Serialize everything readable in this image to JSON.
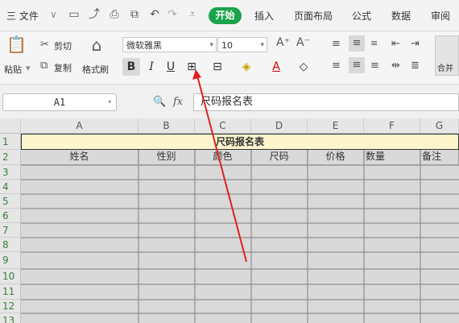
{
  "menubar": {
    "file_label": "三 文件",
    "tabs": [
      "开始",
      "插入",
      "页面布局",
      "公式",
      "数据",
      "审阅"
    ],
    "quick_icons": [
      "save-icon",
      "export-icon",
      "print-icon",
      "preview-icon",
      "undo-icon",
      "redo-icon",
      "more-icon"
    ]
  },
  "ribbon": {
    "paste": "粘贴",
    "cut": "剪切",
    "copy": "复制",
    "format_painter": "格式刷",
    "font_name": "微软雅黑",
    "font_size": "10",
    "bold": "B",
    "italic": "I",
    "underline": "U",
    "merge": "合并"
  },
  "formula_bar": {
    "cell_ref": "A1",
    "fx_label": "fx",
    "content": "尺码报名表"
  },
  "sheet": {
    "columns": [
      "A",
      "B",
      "C",
      "D",
      "E",
      "F",
      "G"
    ],
    "rows": [
      "1",
      "2",
      "3",
      "4",
      "5",
      "6",
      "7",
      "8",
      "9",
      "10",
      "11",
      "12",
      "13"
    ],
    "title": "尺码报名表",
    "headers": [
      "姓名",
      "性别",
      "颜色",
      "尺码",
      "价格",
      "数量",
      "备注"
    ]
  }
}
